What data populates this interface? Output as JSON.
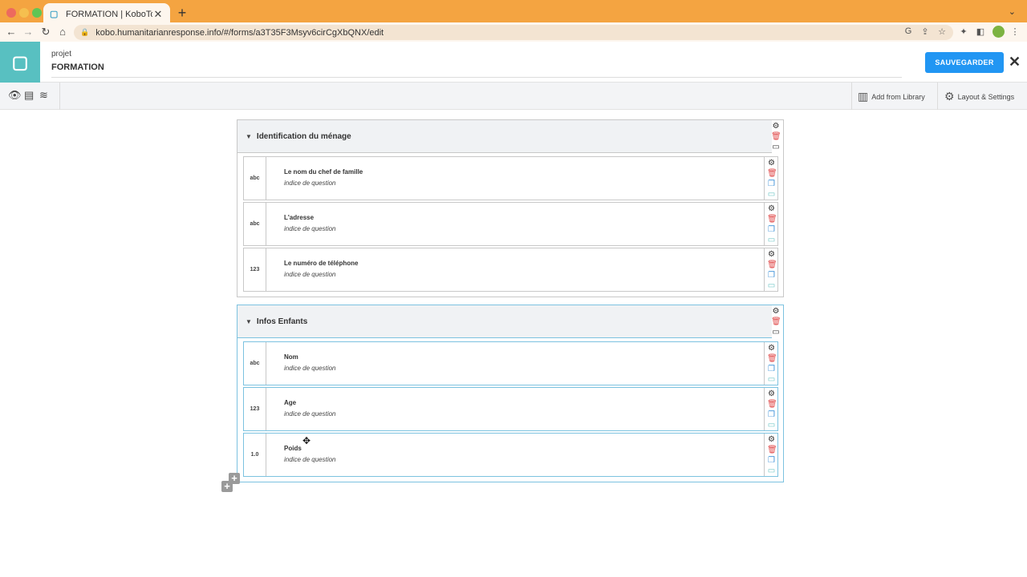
{
  "browser": {
    "tab_title": "FORMATION | KoboToolbox",
    "tab_close": "✕",
    "new_tab": "+",
    "url": "kobo.humanitarianresponse.info/#/forms/a3T35F3Msyv6cirCgXbQNX/edit"
  },
  "header": {
    "project_label": "projet",
    "project_name": "FORMATION",
    "save_label": "SAUVEGARDER",
    "close_label": "✕"
  },
  "toolbar": {
    "add_from_library": "Add from Library",
    "layout_settings": "Layout & Settings"
  },
  "groups": [
    {
      "title": "Identification du ménage",
      "questions": [
        {
          "type": "abc",
          "label": "Le nom du chef de famille",
          "hint": "indice de question"
        },
        {
          "type": "abc",
          "label": "L'adresse",
          "hint": "indice de question"
        },
        {
          "type": "123",
          "label": "Le numéro de téléphone",
          "hint": "indice de question"
        }
      ]
    },
    {
      "title": "Infos Enfants",
      "questions": [
        {
          "type": "abc",
          "label": "Nom",
          "hint": "indice de question"
        },
        {
          "type": "123",
          "label": "Age",
          "hint": "indice de question"
        },
        {
          "type": "1.0",
          "label": "Poids",
          "hint": "indice de question"
        }
      ]
    }
  ],
  "icons": {
    "gear": "⚙",
    "trash": "🗑",
    "copy": "❐",
    "folder": "▭",
    "add": "+",
    "move_cursor": "✥"
  },
  "colors": {
    "logo_bg": "#58c0c1",
    "save_button": "#2196f3",
    "active_group_border": "#7cc2e0",
    "delete_icon": "#e04a4a",
    "copy_icon": "#3a8fd8"
  }
}
